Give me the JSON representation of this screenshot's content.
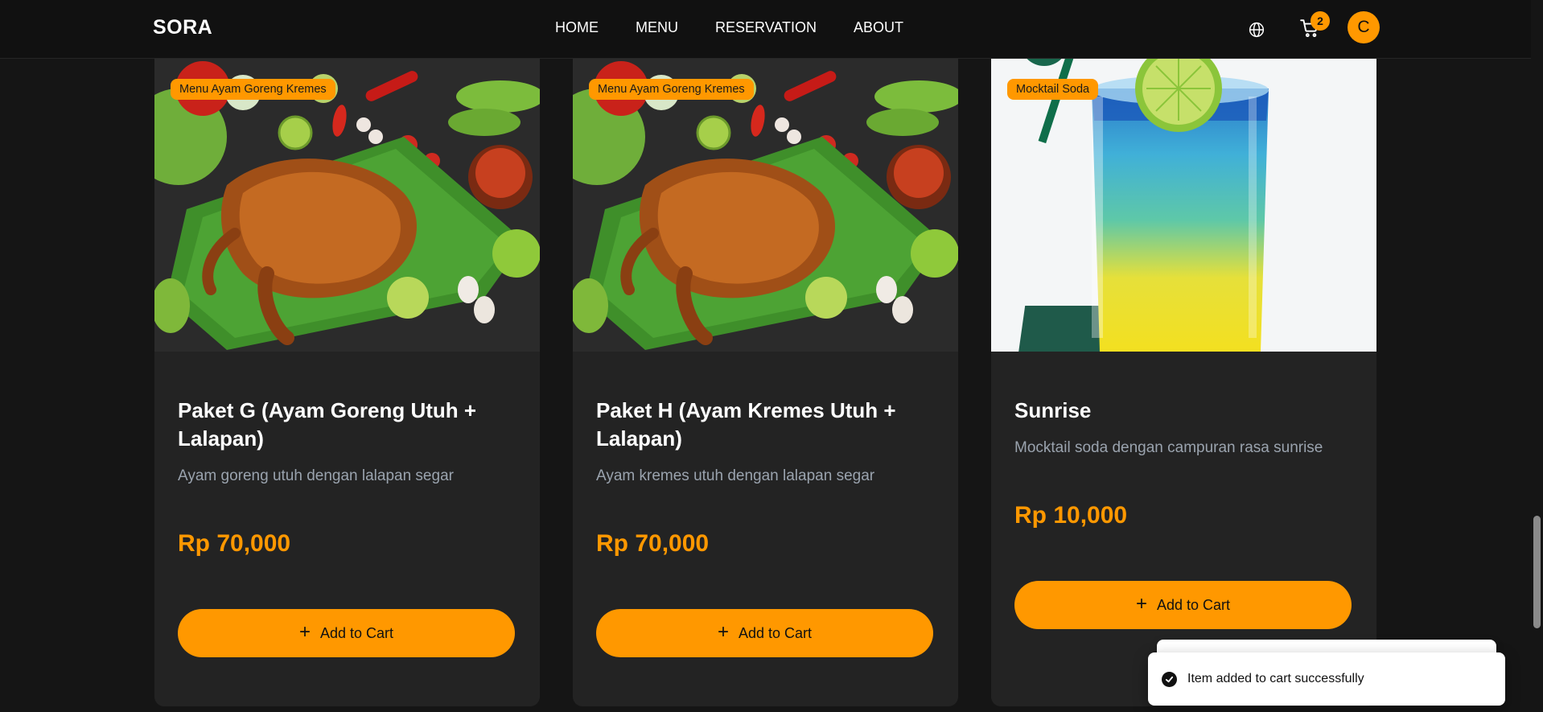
{
  "header": {
    "brand": "SORA",
    "nav": [
      "HOME",
      "MENU",
      "RESERVATION",
      "ABOUT"
    ],
    "cart_count": "2",
    "avatar_initial": "C",
    "icons": [
      "globe-icon",
      "cart-icon"
    ]
  },
  "products": [
    {
      "category": "Menu Ayam Goreng Kremes",
      "title": "Paket G (Ayam Goreng Utuh + Lalapan)",
      "description": "Ayam goreng utuh dengan lalapan segar",
      "price": "Rp 70,000",
      "button_label": "Add to Cart"
    },
    {
      "category": "Menu Ayam Goreng Kremes",
      "title": "Paket H (Ayam Kremes Utuh + Lalapan)",
      "description": "Ayam kremes utuh dengan lalapan segar",
      "price": "Rp 70,000",
      "button_label": "Add to Cart"
    },
    {
      "category": "Mocktail Soda",
      "title": "Sunrise",
      "description": "Mocktail soda dengan campuran rasa sunrise",
      "price": "Rp 10,000",
      "button_label": "Add to Cart"
    }
  ],
  "toast": {
    "message": "Item added to cart successfully",
    "icon": "check-circle-icon"
  },
  "colors": {
    "accent": "#ff9800",
    "background": "#151515",
    "card": "#232323",
    "header": "#111111",
    "muted_text": "#9aa3ae"
  }
}
